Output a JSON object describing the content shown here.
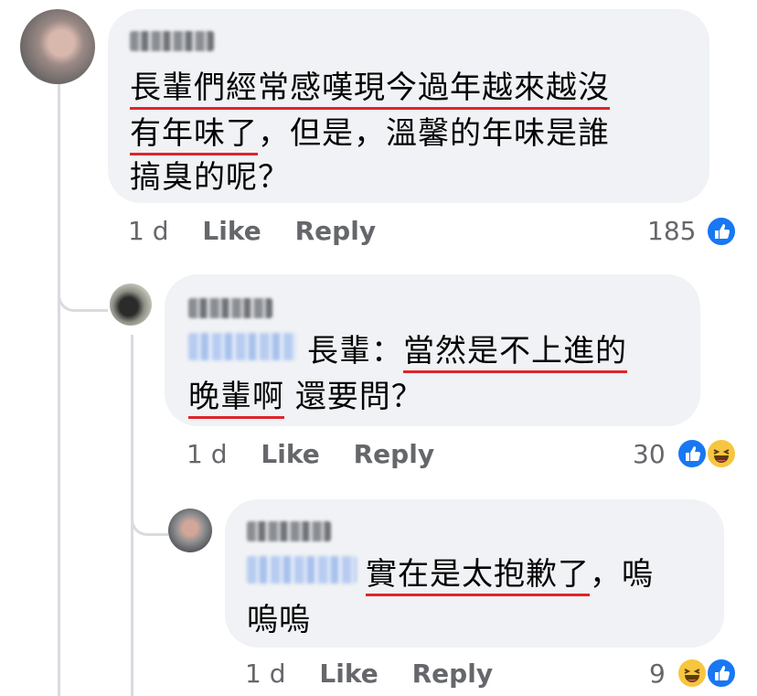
{
  "comments": [
    {
      "text_line1": "長輩們經常感嘆現今過年越來越沒",
      "text_line2_u": "有年味了",
      "text_line2_rest": "，但是，溫馨的年味是誰",
      "text_line3": "搞臭的呢？",
      "time": "1 d",
      "like": "Like",
      "reply": "Reply",
      "reaction_count": "185",
      "reactions": [
        "like-icon"
      ]
    },
    {
      "speaker": "長輩：",
      "text_line1_u": "當然是不上進的",
      "text_line2_u": "晚輩啊",
      "text_line2_rest": "還要問？",
      "time": "1 d",
      "like": "Like",
      "reply": "Reply",
      "reaction_count": "30",
      "reactions": [
        "like-icon",
        "haha-icon"
      ]
    },
    {
      "text_line1_u": "實在是太抱歉了",
      "text_line1_rest": "，嗚",
      "text_line2": "嗚嗚",
      "time": "1 d",
      "like": "Like",
      "reply": "Reply",
      "reaction_count": "9",
      "reactions": [
        "haha-icon",
        "like-icon"
      ]
    }
  ],
  "colors": {
    "bubble": "#f0f2f5",
    "underline": "#e0242b",
    "like_blue": "#1877f2",
    "meta_gray": "#65676b"
  }
}
